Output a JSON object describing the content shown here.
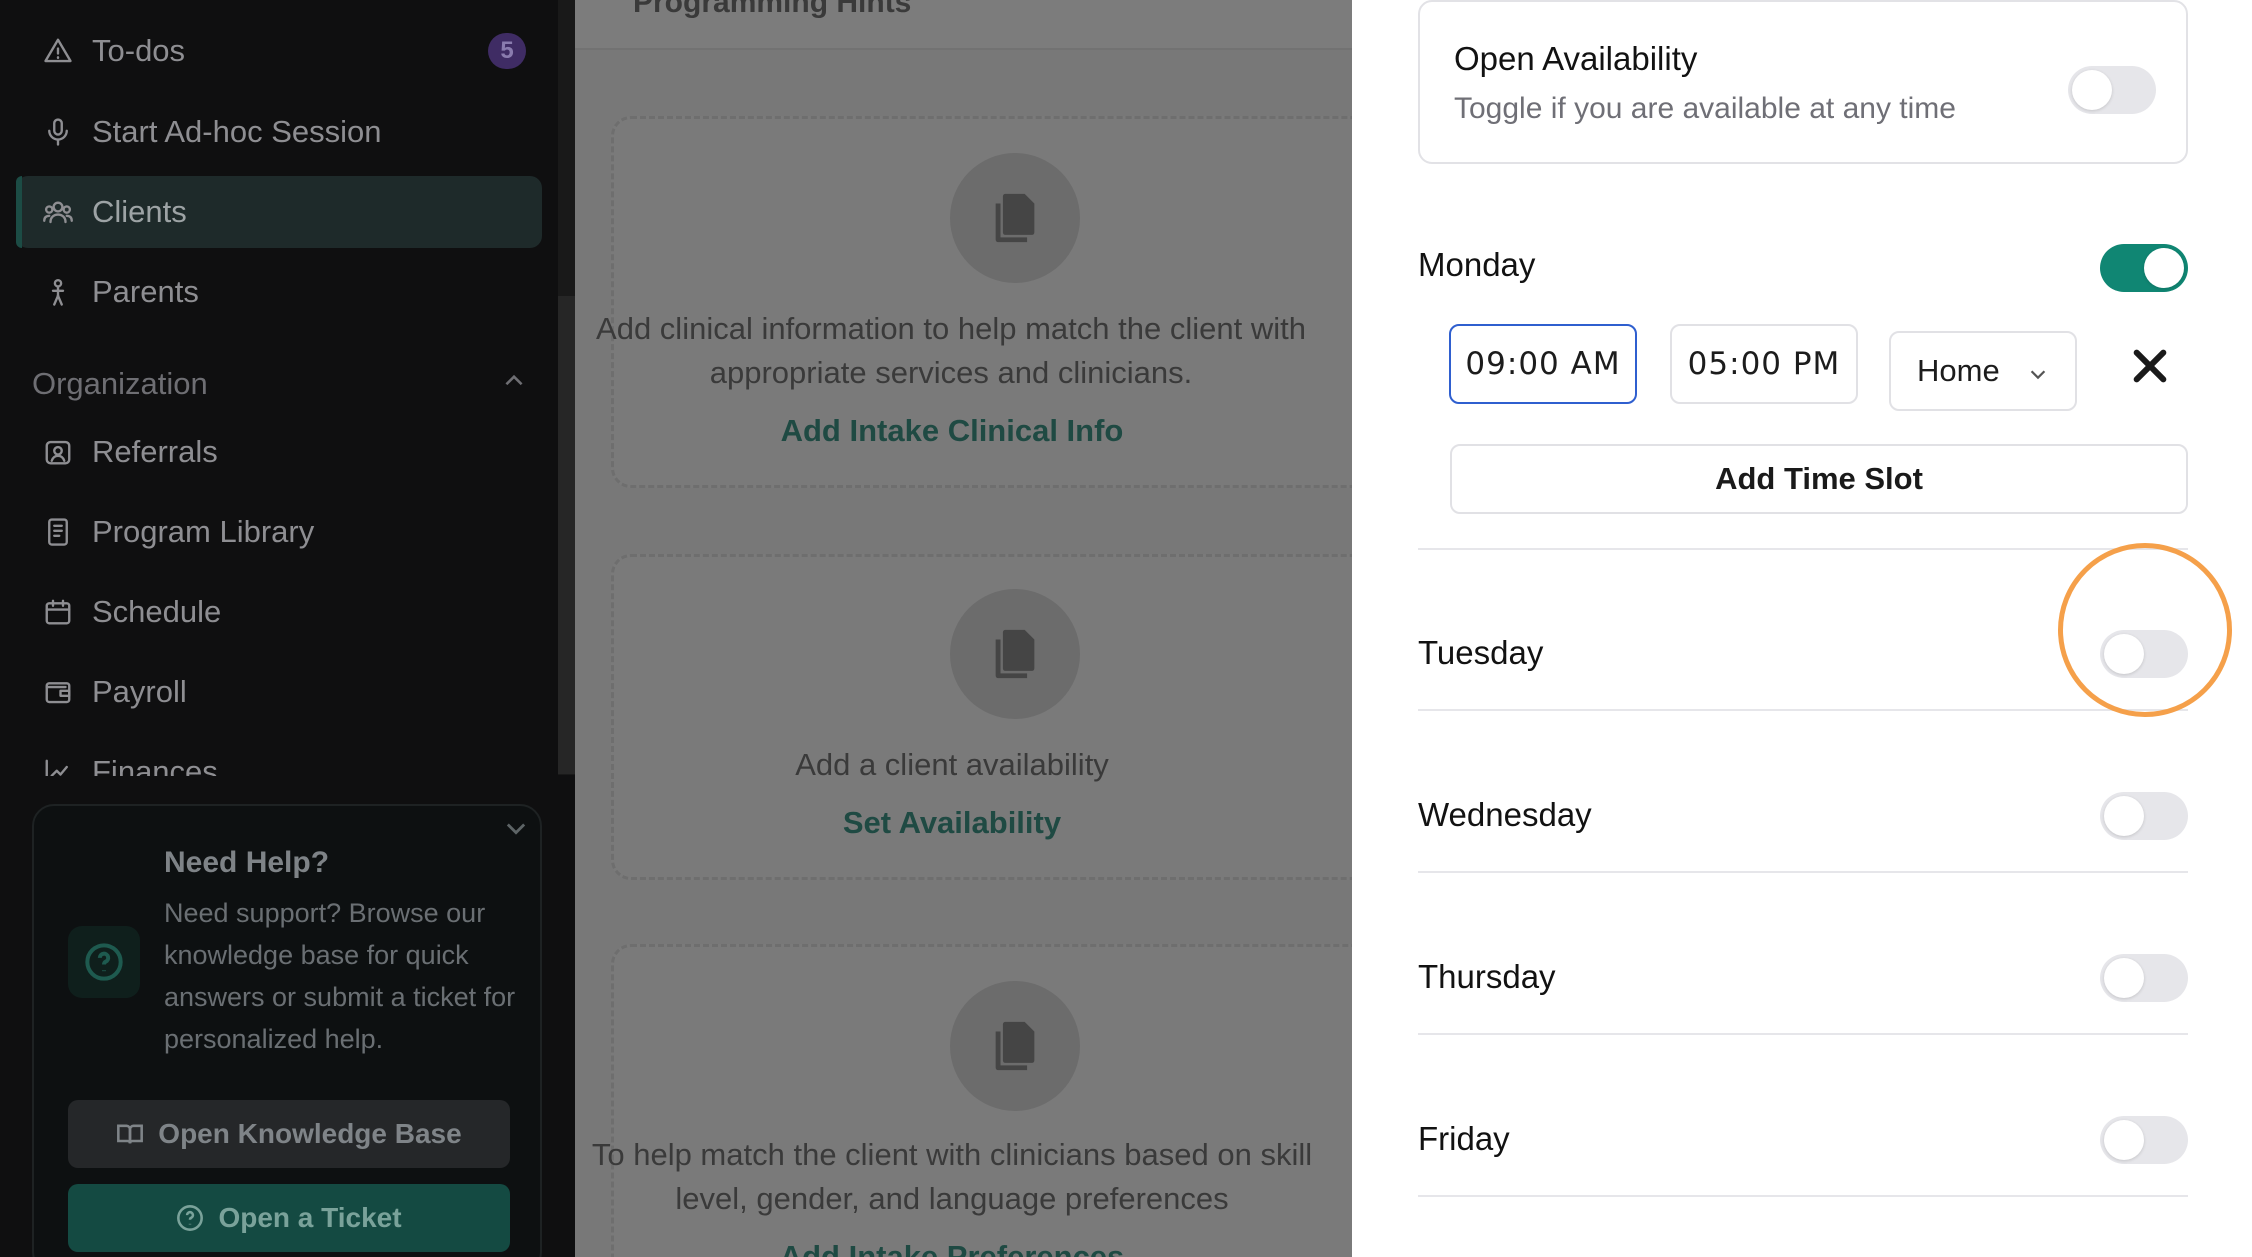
{
  "sidebar": {
    "nav": [
      {
        "label": "To-dos",
        "badge": "5"
      },
      {
        "label": "Start Ad-hoc Session"
      },
      {
        "label": "Clients"
      },
      {
        "label": "Parents"
      }
    ],
    "section": {
      "title": "Organization"
    },
    "org_items": [
      {
        "label": "Referrals"
      },
      {
        "label": "Program Library"
      },
      {
        "label": "Schedule"
      },
      {
        "label": "Payroll"
      },
      {
        "label": "Finances"
      }
    ],
    "help": {
      "title": "Need Help?",
      "text": "Need support? Browse our knowledge base for quick answers or submit a ticket for personalized help.",
      "kb_button": "Open Knowledge Base",
      "ticket_button": "Open a Ticket"
    }
  },
  "main": {
    "header_title": "Programming Hints",
    "cards": [
      {
        "text": "Add clinical information to help match the client with appropriate services and clinicians.",
        "link": "Add Intake Clinical Info"
      },
      {
        "text": "Add a client availability",
        "link": "Set Availability"
      },
      {
        "text": "To help match the client with clinicians based on skill level, gender, and language preferences",
        "link": "Add Intake Preferences"
      }
    ]
  },
  "panel": {
    "open_availability": {
      "title": "Open Availability",
      "subtitle": "Toggle if you are available at any time",
      "enabled": false
    },
    "days": [
      {
        "name": "Monday",
        "enabled": true
      },
      {
        "name": "Tuesday",
        "enabled": false
      },
      {
        "name": "Wednesday",
        "enabled": false
      },
      {
        "name": "Thursday",
        "enabled": false
      },
      {
        "name": "Friday",
        "enabled": false
      }
    ],
    "slot": {
      "start": "09:00 AM",
      "end": "05:00 PM",
      "location": "Home"
    },
    "add_slot_label": "Add Time Slot"
  },
  "colors": {
    "accent": "#108673",
    "focus_border": "#2f5fcf",
    "highlight": "#f5a04a",
    "badge_bg": "#3f2c64"
  }
}
